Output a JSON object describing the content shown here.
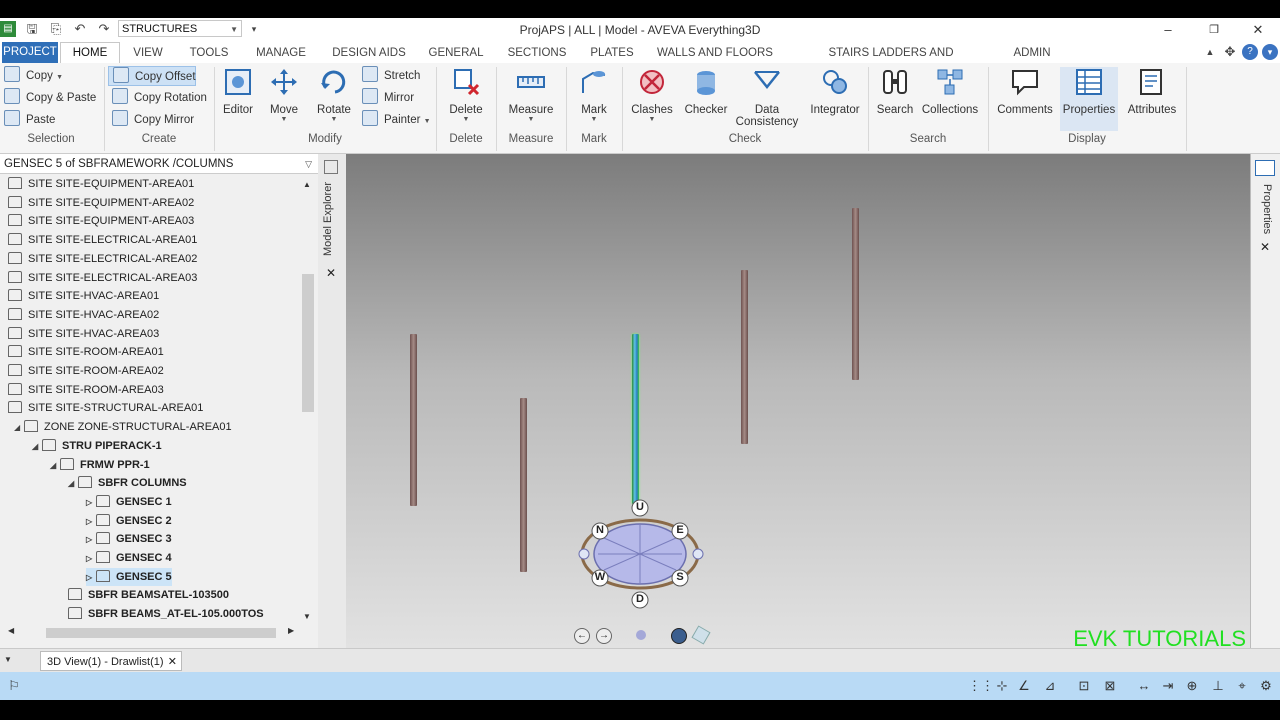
{
  "app": {
    "title": "ProjAPS | ALL | Model - AVEVA Everything3D",
    "module": "STRUCTURES"
  },
  "tabs": [
    "PROJECT",
    "HOME",
    "VIEW",
    "TOOLS",
    "MANAGE",
    "DESIGN AIDS",
    "GENERAL",
    "SECTIONS",
    "PLATES",
    "WALLS AND FLOORS",
    "STAIRS LADDERS AND HANDRAILS",
    "ADMIN"
  ],
  "ribbon": {
    "selection": {
      "copy": "Copy",
      "copy_paste": "Copy & Paste",
      "paste": "Paste",
      "label": "Selection"
    },
    "create": {
      "copy_offset": "Copy Offset",
      "copy_rotation": "Copy Rotation",
      "copy_mirror": "Copy Mirror",
      "label": "Create"
    },
    "modify": {
      "editor": "Editor",
      "move": "Move",
      "rotate": "Rotate",
      "stretch": "Stretch",
      "mirror": "Mirror",
      "painter": "Painter",
      "label": "Modify"
    },
    "delete": {
      "delete": "Delete",
      "label": "Delete"
    },
    "measure": {
      "measure": "Measure",
      "label": "Measure"
    },
    "mark": {
      "mark": "Mark",
      "label": "Mark"
    },
    "check": {
      "clashes": "Clashes",
      "checker": "Checker",
      "data_consistency_1": "Data",
      "data_consistency_2": "Consistency",
      "integrator": "Integrator",
      "label": "Check"
    },
    "search": {
      "search": "Search",
      "collections": "Collections",
      "label": "Search"
    },
    "display": {
      "comments": "Comments",
      "properties": "Properties",
      "attributes": "Attributes",
      "label": "Display"
    }
  },
  "explorer": {
    "header": "GENSEC 5 of SBFRAMEWORK /COLUMNS",
    "side_label": "Model Explorer",
    "items": [
      "SITE SITE-EQUIPMENT-AREA01",
      "SITE SITE-EQUIPMENT-AREA02",
      "SITE SITE-EQUIPMENT-AREA03",
      "SITE SITE-ELECTRICAL-AREA01",
      "SITE SITE-ELECTRICAL-AREA02",
      "SITE SITE-ELECTRICAL-AREA03",
      "SITE SITE-HVAC-AREA01",
      "SITE SITE-HVAC-AREA02",
      "SITE SITE-HVAC-AREA03",
      "SITE SITE-ROOM-AREA01",
      "SITE SITE-ROOM-AREA02",
      "SITE SITE-ROOM-AREA03",
      "SITE SITE-STRUCTURAL-AREA01",
      "ZONE ZONE-STRUCTURAL-AREA01",
      "STRU PIPERACK-1",
      "FRMW PPR-1",
      "SBFR COLUMNS",
      "GENSEC 1",
      "GENSEC 2",
      "GENSEC 3",
      "GENSEC 4",
      "GENSEC 5",
      "SBFR BEAMSATEL-103500",
      "SBFR BEAMS_AT-EL-105.000TOS"
    ]
  },
  "properties_label": "Properties",
  "navcube": {
    "up": "U",
    "down": "D",
    "north": "N",
    "east": "E",
    "south": "S",
    "west": "W"
  },
  "watermark": "EVK TUTORIALS",
  "doc_tab": "3D View(1) - Drawlist(1)"
}
